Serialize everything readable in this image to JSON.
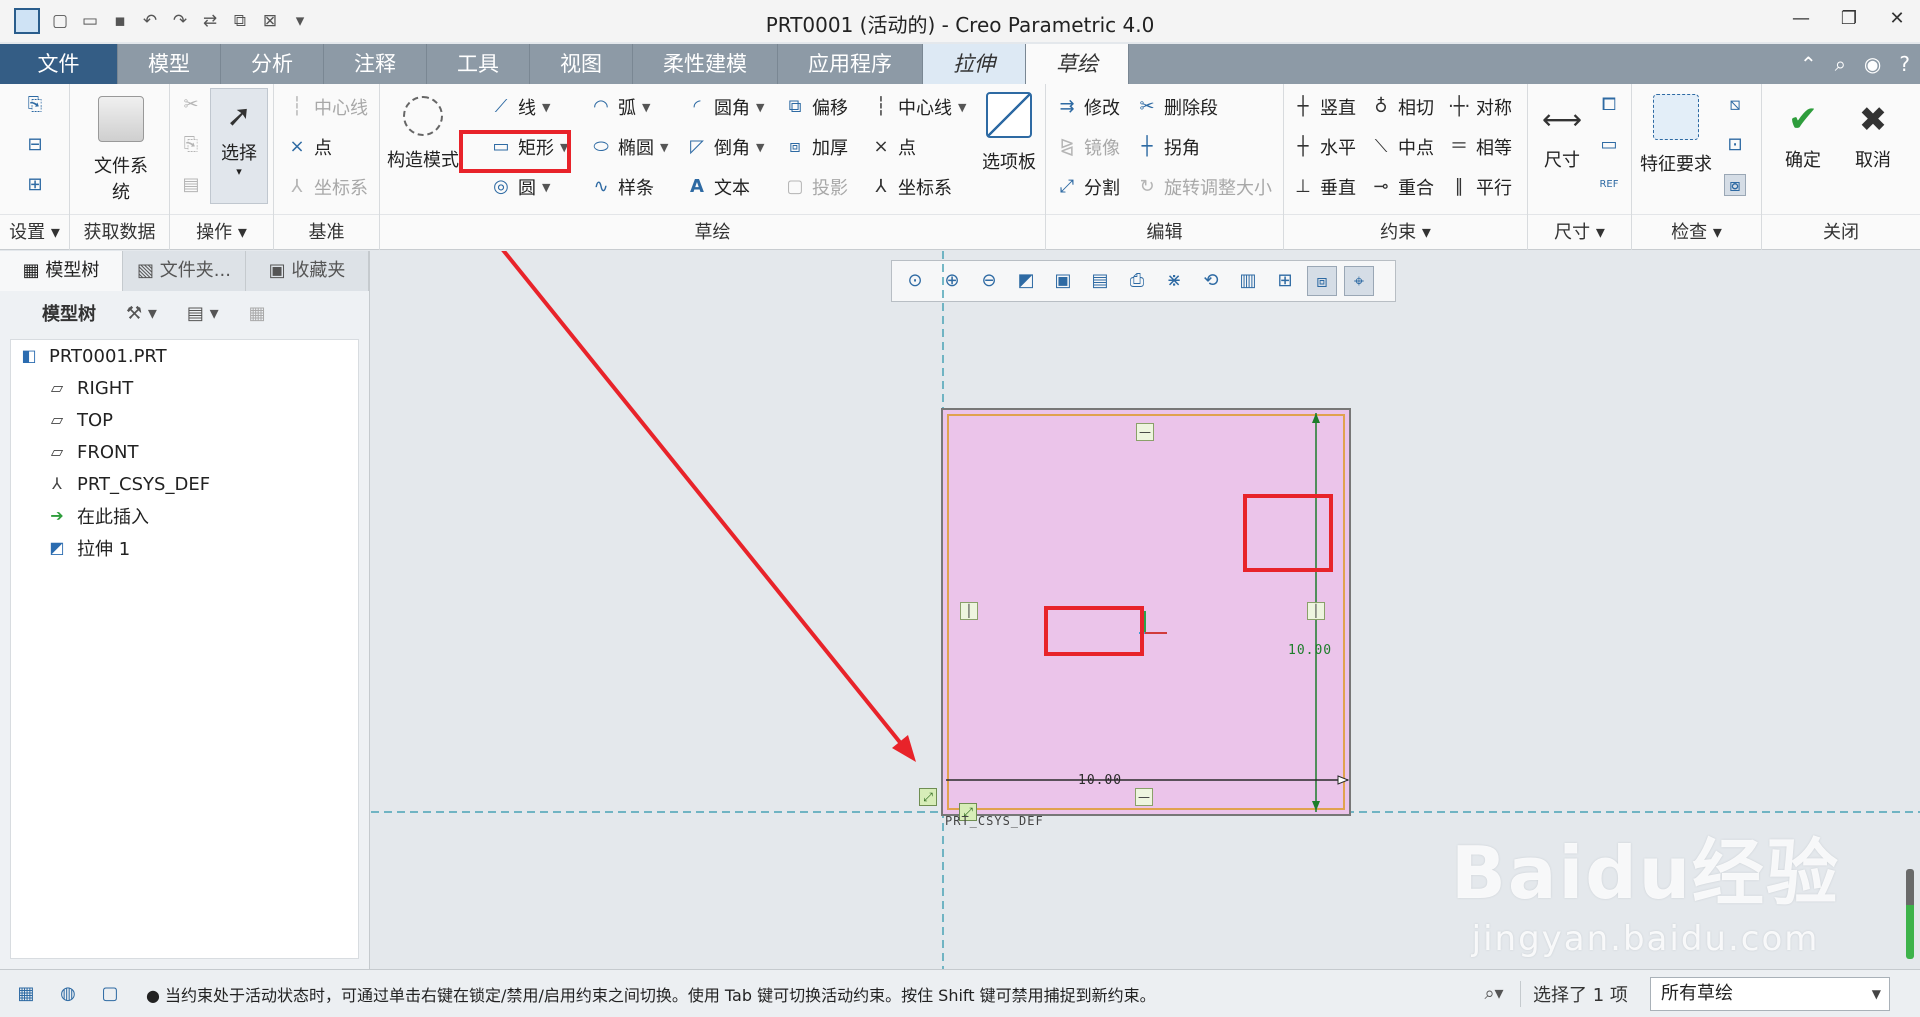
{
  "window": {
    "title": "PRT0001 (活动的) - Creo Parametric 4.0",
    "controls": [
      "minimize-icon",
      "restore-icon",
      "close-icon"
    ]
  },
  "quick_access": [
    "new-icon",
    "open-icon",
    "save-icon",
    "undo-icon",
    "redo-icon",
    "regenerate-icon",
    "windows-icon",
    "close-window-icon",
    "customize-icon"
  ],
  "tabs": [
    {
      "label": "文件"
    },
    {
      "label": "模型"
    },
    {
      "label": "分析"
    },
    {
      "label": "注释"
    },
    {
      "label": "工具"
    },
    {
      "label": "视图"
    },
    {
      "label": "柔性建模"
    },
    {
      "label": "应用程序"
    },
    {
      "label": "拉伸"
    },
    {
      "label": "草绘"
    }
  ],
  "ribbon": {
    "groups": {
      "setup": "设置",
      "get_data": "获取数据",
      "operations": "操作",
      "datum": "基准",
      "sketching": "草绘",
      "editing": "编辑",
      "constrain": "约束",
      "dimension": "尺寸",
      "inspect": "检查",
      "close": "关闭"
    },
    "file_system": "文件系统",
    "select": "选择",
    "datum_items": {
      "centerline": "中心线",
      "point": "点",
      "csys": "坐标系"
    },
    "construction_mode": "构造模式",
    "sketch_items": {
      "line": "线",
      "rectangle": "矩形",
      "circle": "圆",
      "arc": "弧",
      "ellipse": "椭圆",
      "spline": "样条",
      "fillet": "圆角",
      "chamfer": "倒角",
      "text": "文本",
      "offset": "偏移",
      "thicken": "加厚",
      "project": "投影",
      "centerline": "中心线",
      "point": "点",
      "csys": "坐标系"
    },
    "palette": "选项板",
    "edit_items": {
      "modify": "修改",
      "delete_segment": "删除段",
      "mirror": "镜像",
      "corner": "拐角",
      "divide": "分割",
      "rotate_resize": "旋转调整大小"
    },
    "constraint_items": {
      "vertical": "竖直",
      "tangent": "相切",
      "symmetric": "对称",
      "horizontal": "水平",
      "midpoint": "中点",
      "equal": "相等",
      "perpendicular": "垂直",
      "coincident": "重合",
      "parallel": "平行"
    },
    "dimension_label": "尺寸",
    "feature_req": "特征要求",
    "ok": "确定",
    "cancel": "取消"
  },
  "panel": {
    "tabs": [
      "模型树",
      "文件夹...",
      "收藏夹"
    ],
    "tree_title": "模型树",
    "tree": [
      {
        "label": "PRT0001.PRT",
        "icon": "part-icon"
      },
      {
        "label": "RIGHT",
        "icon": "datum-plane-icon"
      },
      {
        "label": "TOP",
        "icon": "datum-plane-icon"
      },
      {
        "label": "FRONT",
        "icon": "datum-plane-icon"
      },
      {
        "label": "PRT_CSYS_DEF",
        "icon": "csys-icon"
      },
      {
        "label": "在此插入",
        "icon": "insert-arrow-icon"
      },
      {
        "label": "拉伸 1",
        "icon": "extrude-icon"
      }
    ]
  },
  "canvas": {
    "dim_horizontal": "10.00",
    "dim_vertical": "10.00",
    "csys_label": "PRT_CSYS_DEF",
    "watermark_brand": "Baidu经验",
    "watermark_url": "jingyan.baidu.com",
    "colors": {
      "sketch_fill": "#ebc4ea",
      "highlight": "#e8232a",
      "dim_vertical": "#1c7d2a",
      "datum_line": "#4aa3b5"
    }
  },
  "status": {
    "message": "● 当约束处于活动状态时，可通过单击右键在锁定/禁用/启用约束之间切换。使用 Tab 键可切换活动约束。按住 Shift 键可禁用捕捉到新约束。",
    "selection": "选择了 1 项",
    "filter": "所有草绘"
  }
}
